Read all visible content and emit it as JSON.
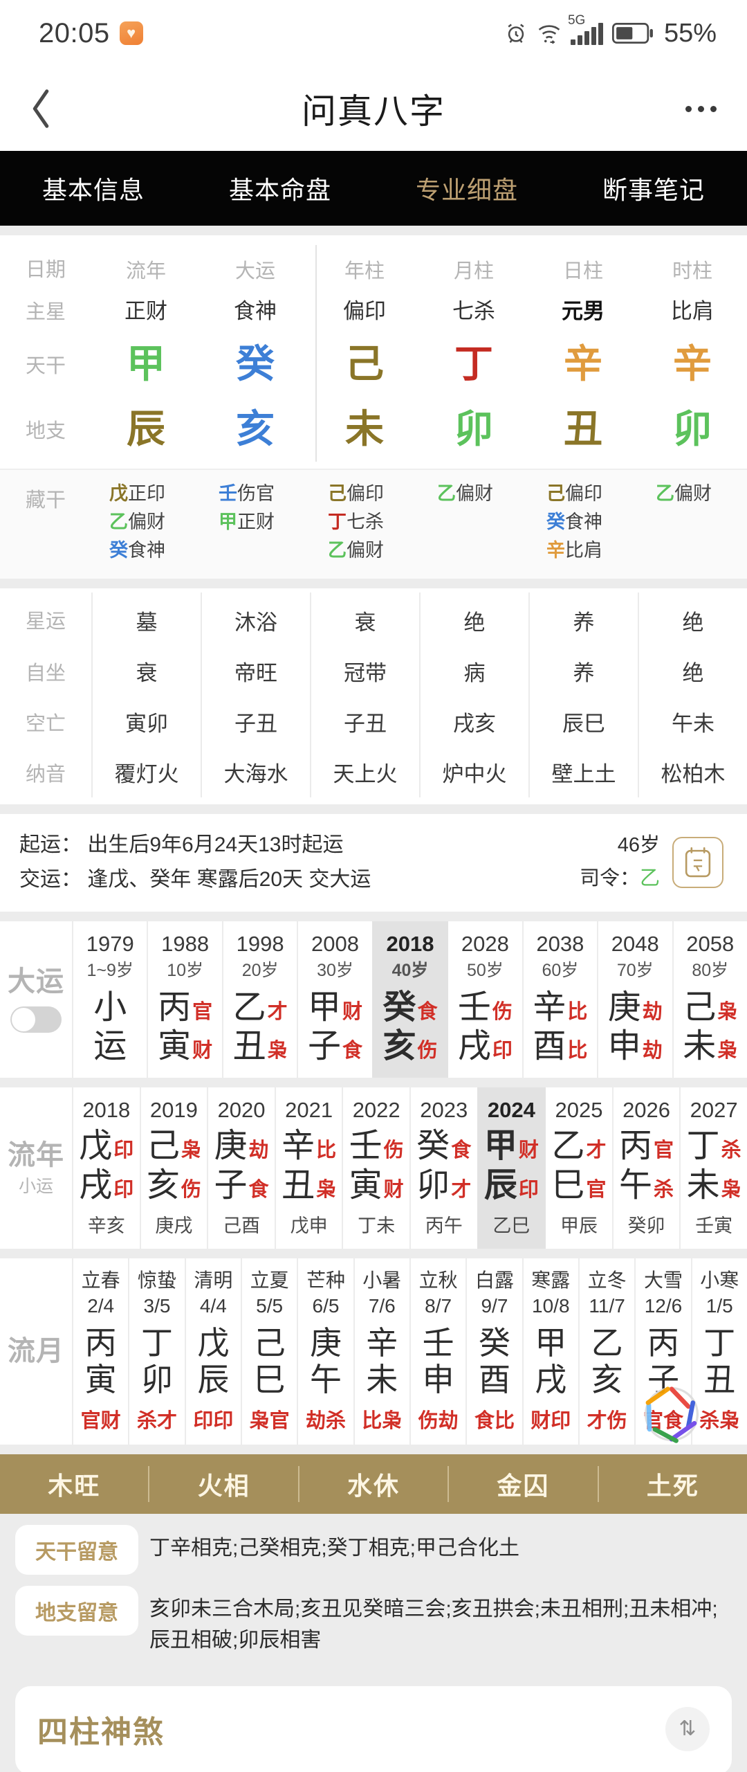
{
  "statusbar": {
    "time": "20:05",
    "battery": "55%",
    "network": "5G",
    "icons": [
      "alarm-icon",
      "wifi-icon",
      "signal-icon",
      "battery-icon"
    ]
  },
  "appbar": {
    "title": "问真八字",
    "back": "‹",
    "more": "⋯"
  },
  "tabs": [
    {
      "label": "基本信息",
      "active": false
    },
    {
      "label": "基本命盘",
      "active": false
    },
    {
      "label": "专业细盘",
      "active": true
    },
    {
      "label": "断事笔记",
      "active": false
    }
  ],
  "chart": {
    "row_labels": {
      "date": "日期",
      "main_star": "主星",
      "heaven_stem": "天干",
      "earth_branch": "地支",
      "hidden": "藏干"
    },
    "columns": [
      {
        "head": "流年",
        "main_star": "正财",
        "main_bold": false,
        "stem": "甲",
        "stem_color": "#5cc25c",
        "branch": "辰",
        "branch_color": "#8a7528",
        "hidden": [
          {
            "g": "戊",
            "gc": "#8a7528",
            "t": "正印"
          },
          {
            "g": "乙",
            "gc": "#5cc25c",
            "t": "偏财"
          },
          {
            "g": "癸",
            "gc": "#3d7fd6",
            "t": "食神"
          }
        ]
      },
      {
        "head": "大运",
        "main_star": "食神",
        "main_bold": false,
        "stem": "癸",
        "stem_color": "#3d7fd6",
        "branch": "亥",
        "branch_color": "#3d7fd6",
        "hidden": [
          {
            "g": "壬",
            "gc": "#3d7fd6",
            "t": "伤官"
          },
          {
            "g": "甲",
            "gc": "#5cc25c",
            "t": "正财"
          }
        ]
      },
      {
        "head": "年柱",
        "main_star": "偏印",
        "main_bold": false,
        "stem": "己",
        "stem_color": "#8a7528",
        "branch": "未",
        "branch_color": "#8a7528",
        "hidden": [
          {
            "g": "己",
            "gc": "#8a7528",
            "t": "偏印"
          },
          {
            "g": "丁",
            "gc": "#c42b22",
            "t": "七杀"
          },
          {
            "g": "乙",
            "gc": "#5cc25c",
            "t": "偏财"
          }
        ]
      },
      {
        "head": "月柱",
        "main_star": "七杀",
        "main_bold": false,
        "stem": "丁",
        "stem_color": "#c42b22",
        "branch": "卯",
        "branch_color": "#5cc25c",
        "hidden": [
          {
            "g": "乙",
            "gc": "#5cc25c",
            "t": "偏财"
          }
        ]
      },
      {
        "head": "日柱",
        "main_star": "元男",
        "main_bold": true,
        "stem": "辛",
        "stem_color": "#e09b3d",
        "branch": "丑",
        "branch_color": "#8a7528",
        "hidden": [
          {
            "g": "己",
            "gc": "#8a7528",
            "t": "偏印"
          },
          {
            "g": "癸",
            "gc": "#3d7fd6",
            "t": "食神"
          },
          {
            "g": "辛",
            "gc": "#e09b3d",
            "t": "比肩"
          }
        ]
      },
      {
        "head": "时柱",
        "main_star": "比肩",
        "main_bold": false,
        "stem": "辛",
        "stem_color": "#e09b3d",
        "branch": "卯",
        "branch_color": "#5cc25c",
        "hidden": [
          {
            "g": "乙",
            "gc": "#5cc25c",
            "t": "偏财"
          }
        ]
      }
    ]
  },
  "stats": {
    "rows": [
      {
        "label": "星运",
        "values": [
          "墓",
          "沐浴",
          "衰",
          "绝",
          "养",
          "绝"
        ]
      },
      {
        "label": "自坐",
        "values": [
          "衰",
          "帝旺",
          "冠带",
          "病",
          "养",
          "绝"
        ]
      },
      {
        "label": "空亡",
        "values": [
          "寅卯",
          "子丑",
          "子丑",
          "戌亥",
          "辰巳",
          "午未"
        ]
      },
      {
        "label": "纳音",
        "values": [
          "覆灯火",
          "大海水",
          "天上火",
          "炉中火",
          "壁上土",
          "松柏木"
        ]
      }
    ]
  },
  "qiyun": {
    "line1": "起运： 出生后9年6月24天13时起运",
    "line2": "交运： 逢戊、癸年 寒露后20天 交大运",
    "age": "46岁",
    "siling_label": "司令：",
    "siling_value": "乙",
    "siling_color": "#5cc25c",
    "calendar_icon": "today-calendar-icon"
  },
  "dayun": {
    "label": "大运",
    "toggle": "xiaoyun-toggle",
    "cols": [
      {
        "year": "1979",
        "age": "1~9岁",
        "stem": "小",
        "stem_god": "",
        "branch": "运",
        "branch_god": "",
        "selected": false
      },
      {
        "year": "1988",
        "age": "10岁",
        "stem": "丙",
        "stem_god": "官",
        "branch": "寅",
        "branch_god": "财",
        "selected": false
      },
      {
        "year": "1998",
        "age": "20岁",
        "stem": "乙",
        "stem_god": "才",
        "branch": "丑",
        "branch_god": "枭",
        "selected": false
      },
      {
        "year": "2008",
        "age": "30岁",
        "stem": "甲",
        "stem_god": "财",
        "branch": "子",
        "branch_god": "食",
        "selected": false
      },
      {
        "year": "2018",
        "age": "40岁",
        "stem": "癸",
        "stem_god": "食",
        "branch": "亥",
        "branch_god": "伤",
        "selected": true
      },
      {
        "year": "2028",
        "age": "50岁",
        "stem": "壬",
        "stem_god": "伤",
        "branch": "戌",
        "branch_god": "印",
        "selected": false
      },
      {
        "year": "2038",
        "age": "60岁",
        "stem": "辛",
        "stem_god": "比",
        "branch": "酉",
        "branch_god": "比",
        "selected": false
      },
      {
        "year": "2048",
        "age": "70岁",
        "stem": "庚",
        "stem_god": "劫",
        "branch": "申",
        "branch_god": "劫",
        "selected": false
      },
      {
        "year": "2058",
        "age": "80岁",
        "stem": "己",
        "stem_god": "枭",
        "branch": "未",
        "branch_god": "枭",
        "selected": false
      }
    ]
  },
  "liunian": {
    "label": "流年",
    "sublabel": "小运",
    "cols": [
      {
        "year": "2018",
        "stem": "戊",
        "stem_god": "印",
        "branch": "戌",
        "branch_god": "印",
        "small": "辛亥",
        "selected": false
      },
      {
        "year": "2019",
        "stem": "己",
        "stem_god": "枭",
        "branch": "亥",
        "branch_god": "伤",
        "small": "庚戌",
        "selected": false
      },
      {
        "year": "2020",
        "stem": "庚",
        "stem_god": "劫",
        "branch": "子",
        "branch_god": "食",
        "small": "己酉",
        "selected": false
      },
      {
        "year": "2021",
        "stem": "辛",
        "stem_god": "比",
        "branch": "丑",
        "branch_god": "枭",
        "small": "戊申",
        "selected": false
      },
      {
        "year": "2022",
        "stem": "壬",
        "stem_god": "伤",
        "branch": "寅",
        "branch_god": "财",
        "small": "丁未",
        "selected": false
      },
      {
        "year": "2023",
        "stem": "癸",
        "stem_god": "食",
        "branch": "卯",
        "branch_god": "才",
        "small": "丙午",
        "selected": false
      },
      {
        "year": "2024",
        "stem": "甲",
        "stem_god": "财",
        "branch": "辰",
        "branch_god": "印",
        "small": "乙巳",
        "selected": true
      },
      {
        "year": "2025",
        "stem": "乙",
        "stem_god": "才",
        "branch": "巳",
        "branch_god": "官",
        "small": "甲辰",
        "selected": false
      },
      {
        "year": "2026",
        "stem": "丙",
        "stem_god": "官",
        "branch": "午",
        "branch_god": "杀",
        "small": "癸卯",
        "selected": false
      },
      {
        "year": "2027",
        "stem": "丁",
        "stem_god": "杀",
        "branch": "未",
        "branch_god": "枭",
        "small": "壬寅",
        "selected": false
      }
    ]
  },
  "liuyue": {
    "label": "流月",
    "cols": [
      {
        "term": "立春",
        "date": "2/4",
        "stem": "丙",
        "branch": "寅",
        "gods": "官财"
      },
      {
        "term": "惊蛰",
        "date": "3/5",
        "stem": "丁",
        "branch": "卯",
        "gods": "杀才"
      },
      {
        "term": "清明",
        "date": "4/4",
        "stem": "戊",
        "branch": "辰",
        "gods": "印印"
      },
      {
        "term": "立夏",
        "date": "5/5",
        "stem": "己",
        "branch": "巳",
        "gods": "枭官"
      },
      {
        "term": "芒种",
        "date": "6/5",
        "stem": "庚",
        "branch": "午",
        "gods": "劫杀"
      },
      {
        "term": "小暑",
        "date": "7/6",
        "stem": "辛",
        "branch": "未",
        "gods": "比枭"
      },
      {
        "term": "立秋",
        "date": "8/7",
        "stem": "壬",
        "branch": "申",
        "gods": "伤劫"
      },
      {
        "term": "白露",
        "date": "9/7",
        "stem": "癸",
        "branch": "酉",
        "gods": "食比"
      },
      {
        "term": "寒露",
        "date": "10/8",
        "stem": "甲",
        "branch": "戌",
        "gods": "财印"
      },
      {
        "term": "立冬",
        "date": "11/7",
        "stem": "乙",
        "branch": "亥",
        "gods": "才伤"
      },
      {
        "term": "大雪",
        "date": "12/6",
        "stem": "丙",
        "branch": "子",
        "gods": "官食"
      },
      {
        "term": "小寒",
        "date": "1/5",
        "stem": "丁",
        "branch": "丑",
        "gods": "杀枭"
      }
    ]
  },
  "wuxing": {
    "bar_color": "#a58f5b",
    "items": [
      "木旺",
      "火相",
      "水休",
      "金囚",
      "土死"
    ]
  },
  "notes": [
    {
      "tag": "天干留意",
      "text": "丁辛相克;己癸相克;癸丁相克;甲己合化土"
    },
    {
      "tag": "地支留意",
      "text": "亥卯未三合木局;亥丑见癸暗三会;亥丑拱会;未丑相刑;丑未相冲;辰丑相破;卯辰相害"
    }
  ],
  "shensha": {
    "title": "四柱神煞",
    "arrow": "⇅",
    "accent": "#a58f5b"
  }
}
